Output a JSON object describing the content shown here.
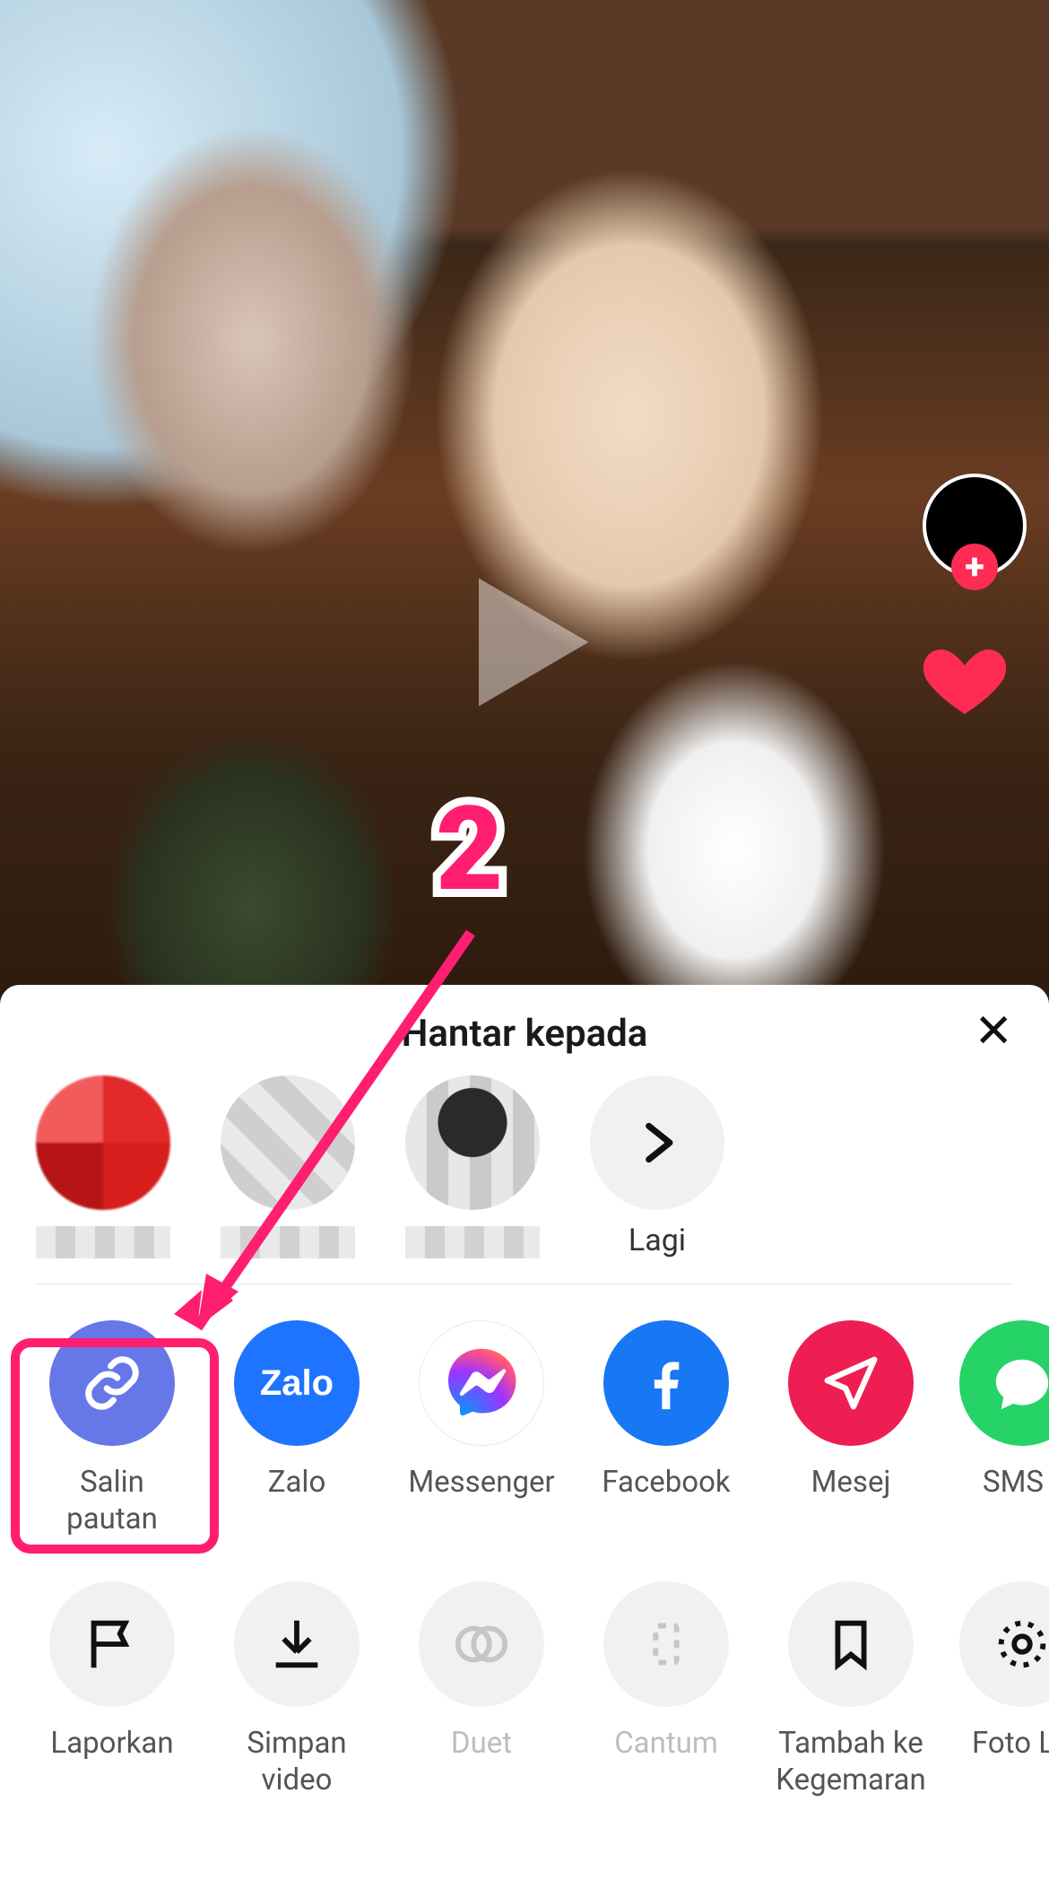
{
  "sheet": {
    "title": "Hantar kepada",
    "close_glyph": "✕",
    "more_label": "Lagi"
  },
  "share_apps": [
    {
      "key": "copylink",
      "label": "Salin pautan"
    },
    {
      "key": "zalo",
      "label": "Zalo"
    },
    {
      "key": "messenger",
      "label": "Messenger"
    },
    {
      "key": "facebook",
      "label": "Facebook"
    },
    {
      "key": "mesej",
      "label": "Mesej"
    },
    {
      "key": "sms",
      "label": "SMS"
    }
  ],
  "actions": [
    {
      "key": "report",
      "label": "Laporkan",
      "disabled": false
    },
    {
      "key": "save",
      "label": "Simpan\nvideo",
      "disabled": false
    },
    {
      "key": "duet",
      "label": "Duet",
      "disabled": true
    },
    {
      "key": "stitch",
      "label": "Cantum",
      "disabled": true
    },
    {
      "key": "favorite",
      "label": "Tambah ke\nKegemaran",
      "disabled": false
    },
    {
      "key": "livephoto",
      "label": "Foto L",
      "disabled": false
    }
  ],
  "zalo_text": "Zalo",
  "annotation": {
    "number": "2"
  }
}
